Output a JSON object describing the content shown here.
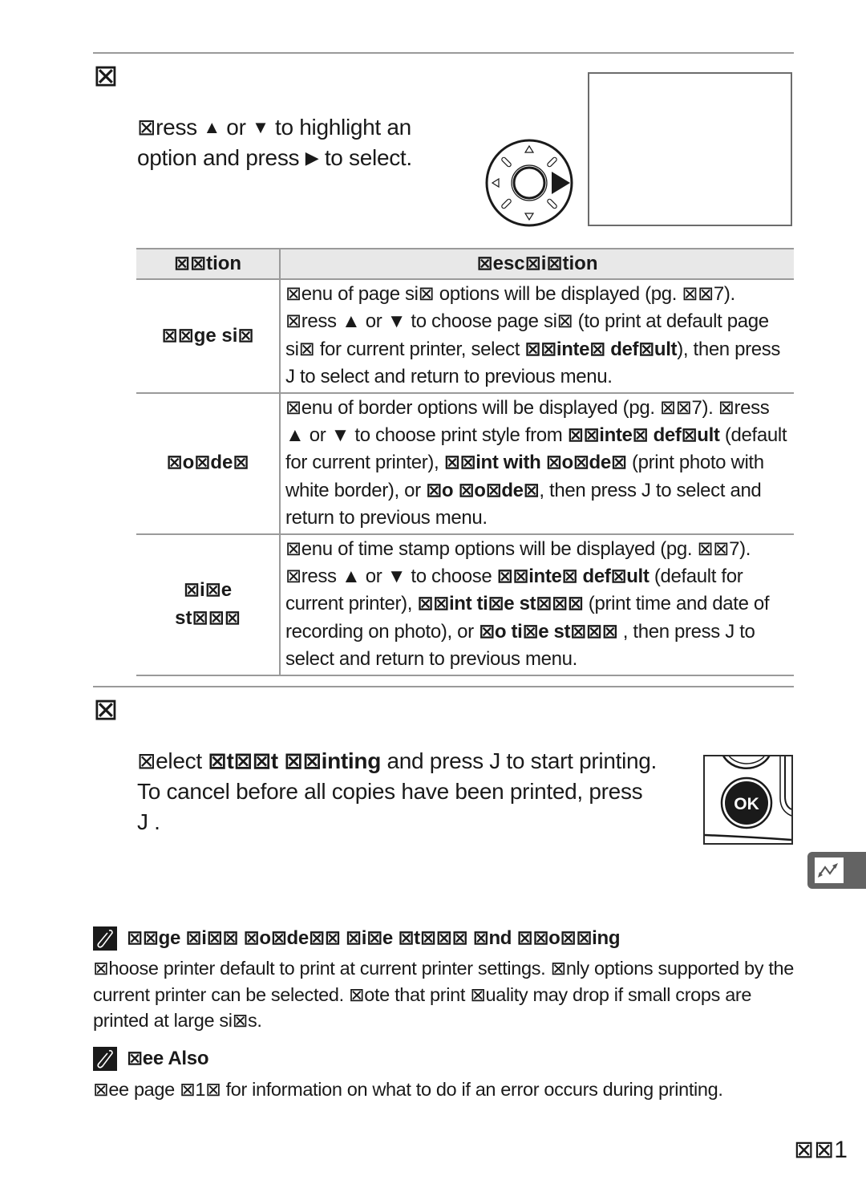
{
  "step_a": {
    "number": "⊠",
    "instruction_parts": [
      "⊠ress ",
      "▲",
      " or ",
      "▼",
      " to highlight an",
      "option and press ",
      "▶",
      " to select."
    ]
  },
  "table": {
    "headers": [
      "⊠⊠tion",
      "⊠esc⊠i⊠tion"
    ],
    "rows": [
      {
        "option": "⊠⊠ge si⊠",
        "description": [
          {
            "t": "⊠enu of page si⊠ options will be displayed (pg. ⊠⊠7)."
          },
          {
            "t": " ⊠ress ▲ or ▼ to choose page si⊠ (to print at default page si⊠ for current printer, select  "
          },
          {
            "t": "⊠⊠inte⊠ def⊠ult",
            "b": true
          },
          {
            "t": "), then press J  to select and return to previous menu."
          }
        ]
      },
      {
        "option": "⊠o⊠de⊠",
        "description": [
          {
            "t": "⊠enu of border options will be displayed (pg. ⊠⊠7).  ⊠ress ▲ or ▼ to choose print style from "
          },
          {
            "t": "⊠⊠inte⊠ def⊠ult",
            "b": true
          },
          {
            "t": " (default for current printer), "
          },
          {
            "t": "⊠⊠int with ⊠o⊠de⊠",
            "b": true
          },
          {
            "t": " (print photo with white border), or "
          },
          {
            "t": "⊠o ⊠o⊠de⊠",
            "b": true
          },
          {
            "t": ", then press J  to select and return to previous menu."
          }
        ]
      },
      {
        "option": "⊠i⊠e st⊠⊠⊠",
        "description": [
          {
            "t": "⊠enu of time stamp options will be displayed (pg. ⊠⊠7). ⊠ress ▲ or ▼ to choose "
          },
          {
            "t": "⊠⊠inte⊠ def⊠ult",
            "b": true
          },
          {
            "t": " (default for current printer), "
          },
          {
            "t": "⊠⊠int ti⊠e st⊠⊠⊠",
            "b": true
          },
          {
            "t": "    (print time and date of recording on photo), or "
          },
          {
            "t": "⊠o ti⊠e st⊠⊠⊠",
            "b": true
          },
          {
            "t": "    , then press J  to select and return to previous menu."
          }
        ]
      }
    ]
  },
  "step_b": {
    "number": "⊠",
    "line1_pre": "⊠elect  ",
    "line1_bold": "⊠t⊠⊠t ⊠⊠inting",
    "line1_post": " and press J  to start printing.",
    "line2": "To cancel before all copies have been printed, press",
    "line3": "J ."
  },
  "ok_button_label": "OK",
  "notes": [
    {
      "icon": "pencil-icon",
      "title": "⊠⊠ge ⊠i⊠⊠ ⊠o⊠de⊠⊠ ⊠i⊠e ⊠t⊠⊠⊠ ⊠nd ⊠⊠o⊠⊠ing",
      "body": "⊠hoose printer default to print at current printer settings.  ⊠nly options supported by the current printer can be selected.  ⊠ote that print ⊠uality may drop if small crops are printed at large si⊠s."
    },
    {
      "icon": "pencil-icon",
      "title": "⊠ee Also",
      "body": "⊠ee page ⊠1⊠ for information on what to do if an error occurs during printing."
    }
  ],
  "side_tab_icon": "connection-icon",
  "page_number": "⊠⊠1"
}
